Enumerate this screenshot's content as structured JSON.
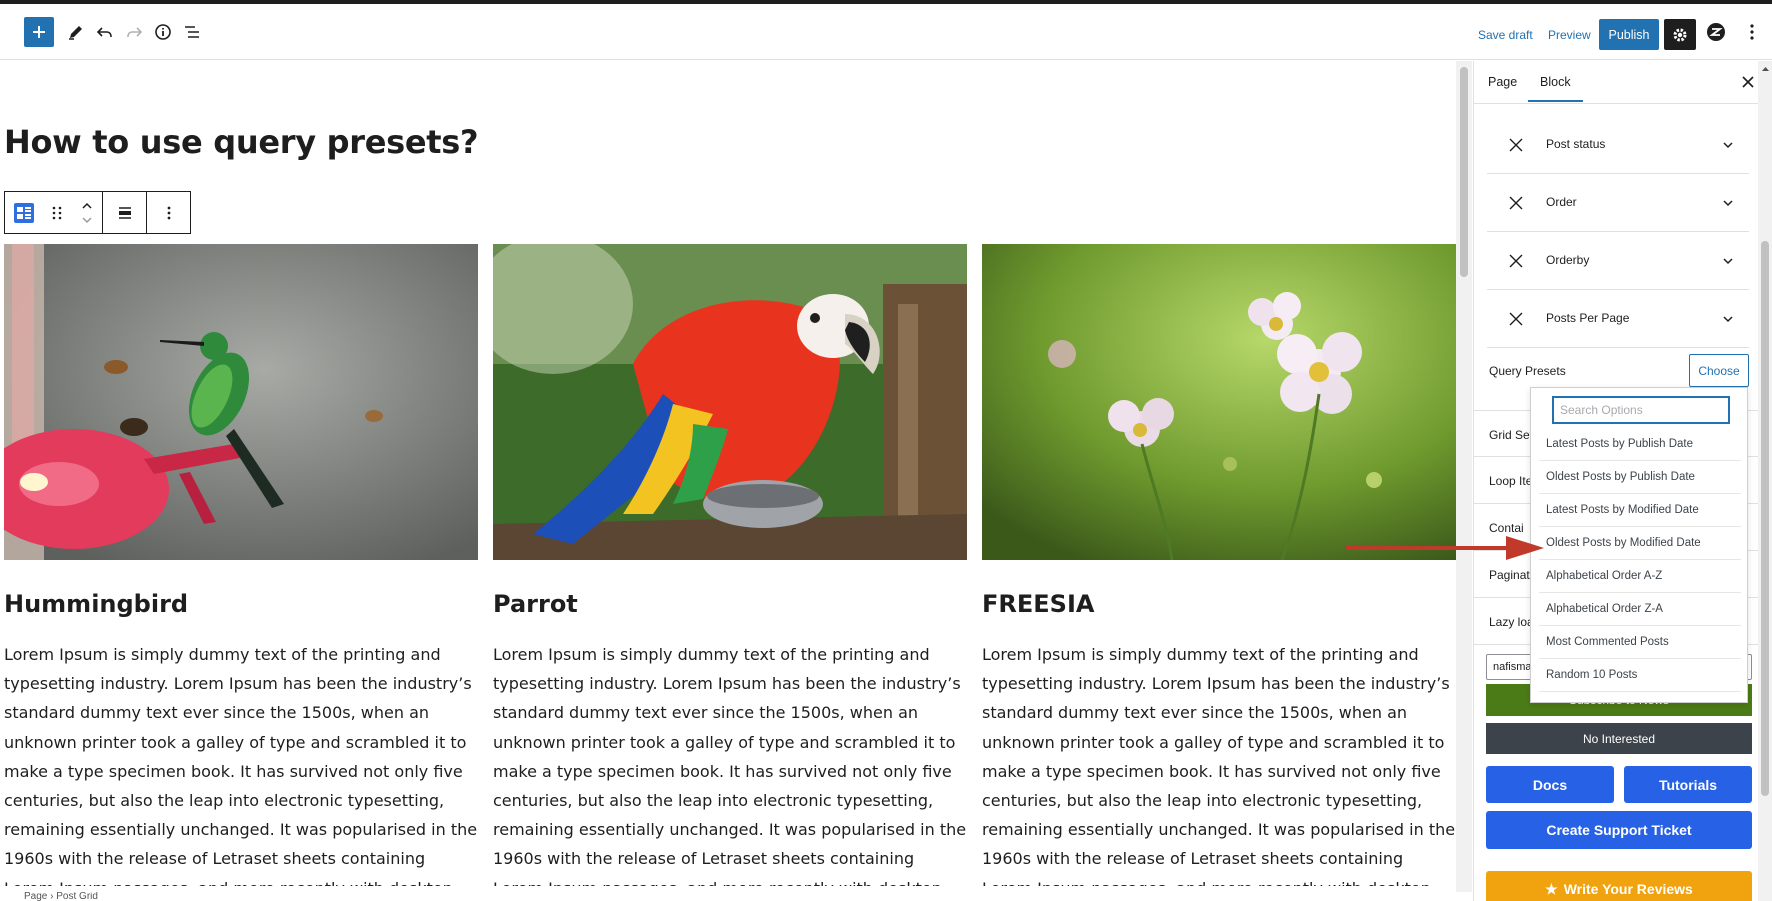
{
  "toolbar": {
    "save_draft": "Save draft",
    "preview": "Preview",
    "publish": "Publish"
  },
  "page": {
    "title": "How to use query presets?"
  },
  "posts": [
    {
      "title": "Hummingbird",
      "excerpt": "Lorem Ipsum is simply dummy text of the printing and typesetting industry. Lorem Ipsum has been the industry’s standard dummy text ever since the 1500s, when an unknown printer took a galley of type and scrambled it to make a type specimen book. It has survived not only five centuries, but also the leap into electronic typesetting, remaining essentially unchanged. It was popularised in the 1960s with the release of Letraset sheets containing Lorem Ipsum passages, and more recently with desktop publishing software like Aldus PageMaker including versions of Lorem Ipsum."
    },
    {
      "title": "Parrot",
      "excerpt": "Lorem Ipsum is simply dummy text of the printing and typesetting industry. Lorem Ipsum has been the industry’s standard dummy text ever since the 1500s, when an unknown printer took a galley of type and scrambled it to make a type specimen book. It has survived not only five centuries, but also the leap into electronic typesetting, remaining essentially unchanged. It was popularised in the 1960s with the release of Letraset sheets containing Lorem Ipsum passages, and more recently with desktop publishing software like Aldus PageMaker including versions of Lorem Ipsum."
    },
    {
      "title": "FREESIA",
      "excerpt": "Lorem Ipsum is simply dummy text of the printing and typesetting industry. Lorem Ipsum has been the industry’s standard dummy text ever since the 1500s, when an unknown printer took a galley of type and scrambled it to make a type specimen book. It has survived not only five centuries, but also the leap into electronic typesetting, remaining essentially unchanged. It was popularised in the 1960s with the release of Letraset sheets containing Lorem Ipsum passages, and more recently with desktop publishing software like Aldus PageMaker including versions of Lorem Ipsum."
    }
  ],
  "breadcrumb": {
    "items": [
      "Page",
      "Post Grid"
    ]
  },
  "sidebar": {
    "tabs": [
      "Page",
      "Block"
    ],
    "taxonomy_rows": [
      "Post status",
      "Order",
      "Orderby",
      "Posts Per Page"
    ],
    "query_presets_label": "Query Presets",
    "choose_label": "Choose",
    "sections": [
      "Grid Set",
      "Loop Ite",
      "Contai",
      "Paginati",
      "Lazy loa"
    ],
    "user_input_value": "nafisma",
    "subscribe_label": "Subscribe to News",
    "no_interest_label": "No Interested",
    "docs_label": "Docs",
    "tutorials_label": "Tutorials",
    "support_label": "Create Support Ticket",
    "review_label": "Write Your Reviews"
  },
  "dropdown": {
    "search_placeholder": "Search Options",
    "options": [
      "Latest Posts by Publish Date",
      "Oldest Posts by Publish Date",
      "Latest Posts by Modified Date",
      "Oldest Posts by Modified Date",
      "Alphabetical Order A-Z",
      "Alphabetical Order Z-A",
      "Most Commented Posts",
      "Random 10 Posts"
    ]
  },
  "colors": {
    "accent": "#2271b1",
    "arrow": "#c0392b",
    "subscribe": "#4b7b16",
    "dark_button": "#3c434a",
    "blue_button": "#2762e6",
    "review_button": "#f0a20f"
  }
}
